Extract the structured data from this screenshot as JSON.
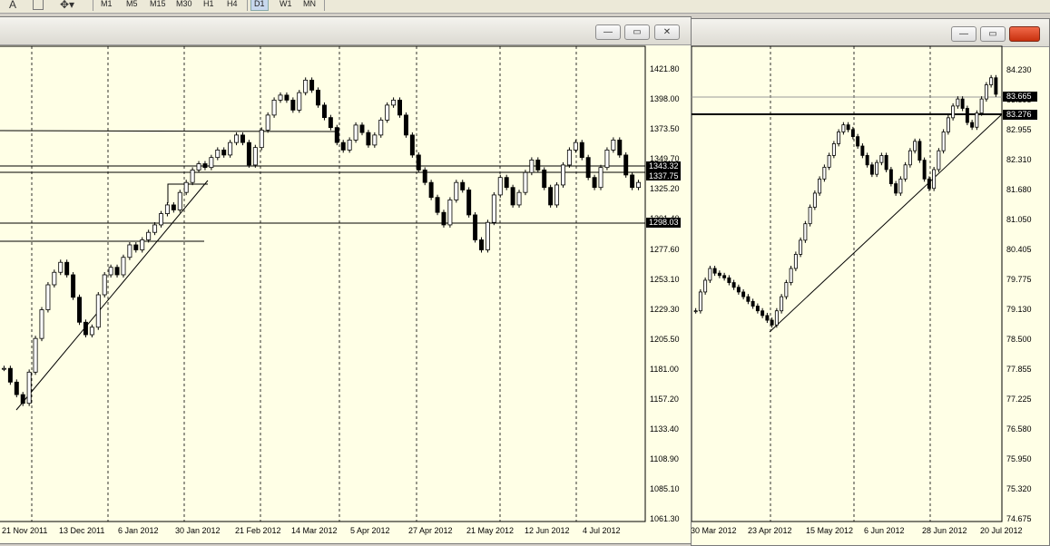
{
  "toolbar": {
    "text_tool": "A",
    "timeframes": [
      "M1",
      "M5",
      "M15",
      "M30",
      "H1",
      "H4",
      "D1",
      "W1",
      "MN"
    ],
    "active_timeframe": "D1"
  },
  "left_chart": {
    "window_buttons": {
      "minimize": "—",
      "maximize": "▭",
      "close": "✕"
    },
    "price_labels": [
      "1421.80",
      "1398.00",
      "1373.50",
      "1349.70",
      "1325.20",
      "1301.40",
      "1277.60",
      "1253.10",
      "1229.30",
      "1205.50",
      "1181.00",
      "1157.20",
      "1133.40",
      "1108.90",
      "1085.10",
      "1061.30"
    ],
    "date_labels": [
      "21 Nov 2011",
      "13 Dec 2011",
      "6 Jan 2012",
      "30 Jan 2012",
      "21 Feb 2012",
      "14 Mar 2012",
      "5 Apr 2012",
      "27 Apr 2012",
      "21 May 2012",
      "12 Jun 2012",
      "4 Jul 2012"
    ],
    "marker_labels": [
      "1343.32",
      "1337.75",
      "1298.03"
    ],
    "ylim": [
      1061.3,
      1421.8
    ],
    "candle_path": [
      [
        1181,
        1187
      ],
      [
        1170,
        1176
      ],
      [
        1160,
        1166
      ],
      [
        1153,
        1159
      ],
      [
        1178,
        1184
      ],
      [
        1205,
        1211
      ],
      [
        1228,
        1234
      ],
      [
        1248,
        1254
      ],
      [
        1258,
        1264
      ],
      [
        1266,
        1272
      ],
      [
        1256,
        1262
      ],
      [
        1238,
        1244
      ],
      [
        1218,
        1224
      ],
      [
        1208,
        1214
      ],
      [
        1214,
        1220
      ],
      [
        1240,
        1246
      ],
      [
        1256,
        1262
      ],
      [
        1262,
        1268
      ],
      [
        1256,
        1262
      ],
      [
        1270,
        1276
      ],
      [
        1280,
        1286
      ],
      [
        1276,
        1282
      ],
      [
        1284,
        1290
      ],
      [
        1290,
        1296
      ],
      [
        1296,
        1302
      ],
      [
        1305,
        1311
      ],
      [
        1312,
        1318
      ],
      [
        1308,
        1314
      ],
      [
        1322,
        1328
      ],
      [
        1330,
        1336
      ],
      [
        1340,
        1346
      ],
      [
        1345,
        1351
      ],
      [
        1342,
        1348
      ],
      [
        1350,
        1356
      ],
      [
        1356,
        1362
      ],
      [
        1352,
        1358
      ],
      [
        1362,
        1368
      ],
      [
        1368,
        1374
      ],
      [
        1362,
        1368
      ],
      [
        1344,
        1350
      ],
      [
        1358,
        1364
      ],
      [
        1372,
        1378
      ],
      [
        1384,
        1390
      ],
      [
        1396,
        1402
      ],
      [
        1400,
        1406
      ],
      [
        1396,
        1402
      ],
      [
        1388,
        1394
      ],
      [
        1402,
        1408
      ],
      [
        1412,
        1418
      ],
      [
        1404,
        1410
      ],
      [
        1392,
        1398
      ],
      [
        1382,
        1388
      ],
      [
        1374,
        1380
      ],
      [
        1362,
        1368
      ],
      [
        1356,
        1362
      ],
      [
        1364,
        1370
      ],
      [
        1376,
        1382
      ],
      [
        1370,
        1376
      ],
      [
        1360,
        1366
      ],
      [
        1368,
        1374
      ],
      [
        1380,
        1386
      ],
      [
        1392,
        1398
      ],
      [
        1396,
        1402
      ],
      [
        1384,
        1390
      ],
      [
        1368,
        1374
      ],
      [
        1352,
        1358
      ],
      [
        1340,
        1346
      ],
      [
        1330,
        1336
      ],
      [
        1318,
        1324
      ],
      [
        1306,
        1312
      ],
      [
        1296,
        1302
      ],
      [
        1316,
        1322
      ],
      [
        1330,
        1336
      ],
      [
        1324,
        1330
      ],
      [
        1304,
        1310
      ],
      [
        1284,
        1290
      ],
      [
        1276,
        1282
      ],
      [
        1298,
        1304
      ],
      [
        1320,
        1326
      ],
      [
        1334,
        1340
      ],
      [
        1326,
        1332
      ],
      [
        1312,
        1318
      ],
      [
        1322,
        1328
      ],
      [
        1338,
        1344
      ],
      [
        1348,
        1354
      ],
      [
        1340,
        1346
      ],
      [
        1326,
        1332
      ],
      [
        1312,
        1318
      ],
      [
        1328,
        1334
      ],
      [
        1344,
        1350
      ],
      [
        1356,
        1362
      ],
      [
        1362,
        1368
      ],
      [
        1350,
        1356
      ],
      [
        1334,
        1340
      ],
      [
        1326,
        1332
      ],
      [
        1342,
        1348
      ],
      [
        1356,
        1362
      ],
      [
        1364,
        1370
      ],
      [
        1352,
        1358
      ],
      [
        1336,
        1342
      ],
      [
        1326,
        1332
      ],
      [
        1330,
        1336
      ]
    ],
    "colors": {
      "background": "#ffffe6",
      "candles": "#000000"
    }
  },
  "right_chart": {
    "window_buttons": {
      "minimize": "—",
      "maximize": "▭",
      "close": " "
    },
    "price_labels": [
      "84.230",
      "83.595",
      "82.955",
      "82.310",
      "81.680",
      "81.050",
      "80.405",
      "79.775",
      "79.130",
      "78.500",
      "77.855",
      "77.225",
      "76.580",
      "75.950",
      "75.320",
      "74.675"
    ],
    "date_labels": [
      "30 Mar 2012",
      "23 Apr 2012",
      "15 May 2012",
      "6 Jun 2012",
      "28 Jun 2012",
      "20 Jul 2012"
    ],
    "marker_labels": [
      "83.665",
      "83.276"
    ],
    "ylim": [
      74.675,
      84.23
    ],
    "candle_path": [
      [
        79.1,
        79.2
      ],
      [
        79.5,
        79.6
      ],
      [
        79.75,
        79.85
      ],
      [
        80.0,
        80.1
      ],
      [
        79.9,
        80.0
      ],
      [
        79.85,
        79.95
      ],
      [
        79.8,
        79.9
      ],
      [
        79.7,
        79.8
      ],
      [
        79.6,
        79.7
      ],
      [
        79.5,
        79.6
      ],
      [
        79.4,
        79.5
      ],
      [
        79.3,
        79.4
      ],
      [
        79.2,
        79.3
      ],
      [
        79.1,
        79.2
      ],
      [
        79.0,
        79.1
      ],
      [
        78.9,
        79.0
      ],
      [
        78.8,
        78.9
      ],
      [
        79.1,
        79.2
      ],
      [
        79.4,
        79.5
      ],
      [
        79.7,
        79.8
      ],
      [
        80.0,
        80.1
      ],
      [
        80.3,
        80.4
      ],
      [
        80.6,
        80.7
      ],
      [
        80.95,
        81.05
      ],
      [
        81.3,
        81.4
      ],
      [
        81.6,
        81.7
      ],
      [
        81.9,
        82.0
      ],
      [
        82.15,
        82.25
      ],
      [
        82.4,
        82.5
      ],
      [
        82.65,
        82.75
      ],
      [
        82.9,
        83.0
      ],
      [
        83.05,
        83.15
      ],
      [
        82.95,
        83.05
      ],
      [
        82.8,
        82.9
      ],
      [
        82.6,
        82.7
      ],
      [
        82.4,
        82.5
      ],
      [
        82.2,
        82.3
      ],
      [
        82.0,
        82.1
      ],
      [
        82.25,
        82.35
      ],
      [
        82.4,
        82.5
      ],
      [
        82.1,
        82.2
      ],
      [
        81.8,
        81.9
      ],
      [
        81.6,
        81.7
      ],
      [
        81.9,
        82.0
      ],
      [
        82.2,
        82.3
      ],
      [
        82.5,
        82.6
      ],
      [
        82.7,
        82.8
      ],
      [
        82.3,
        82.4
      ],
      [
        81.9,
        82.0
      ],
      [
        81.7,
        81.8
      ],
      [
        82.1,
        82.2
      ],
      [
        82.5,
        82.6
      ],
      [
        82.9,
        83.0
      ],
      [
        83.2,
        83.3
      ],
      [
        83.45,
        83.55
      ],
      [
        83.6,
        83.7
      ],
      [
        83.4,
        83.5
      ],
      [
        83.1,
        83.2
      ],
      [
        83.0,
        83.1
      ],
      [
        83.3,
        83.4
      ],
      [
        83.6,
        83.7
      ],
      [
        83.9,
        84.0
      ],
      [
        84.05,
        84.15
      ],
      [
        83.7,
        83.8
      ]
    ],
    "colors": {
      "background": "#ffffe6",
      "candles": "#000000"
    }
  }
}
